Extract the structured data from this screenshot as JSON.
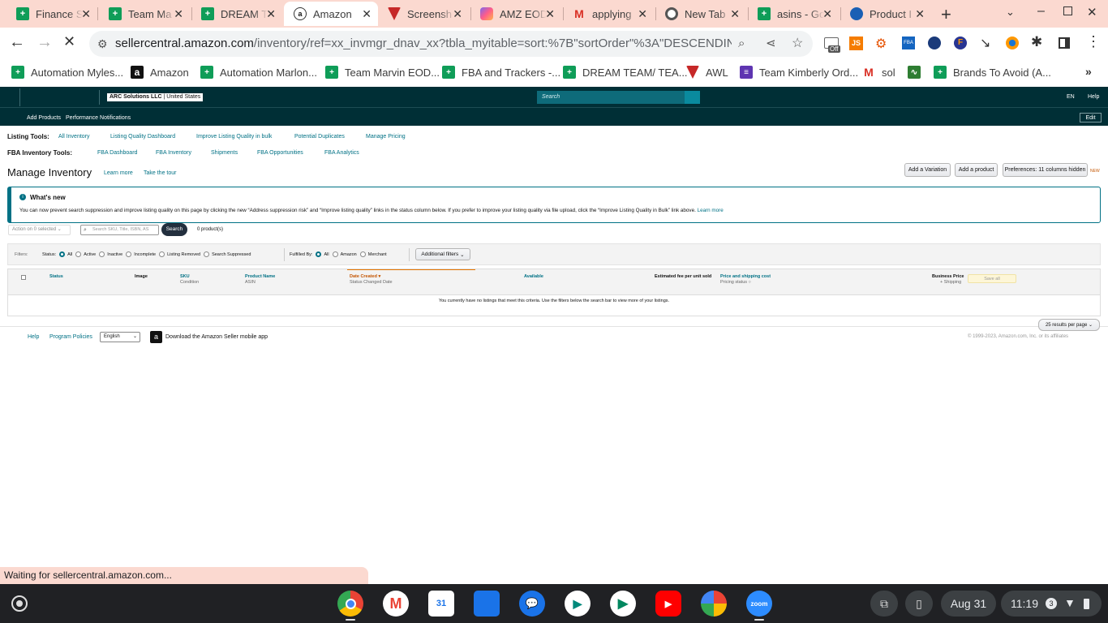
{
  "browser": {
    "tabs": [
      {
        "label": "Finance S",
        "icon": "sheets-icon"
      },
      {
        "label": "Team Ma",
        "icon": "sheets-icon"
      },
      {
        "label": "DREAM T",
        "icon": "sheets-icon"
      },
      {
        "label": "Amazon",
        "icon": "amazon-icon"
      },
      {
        "label": "Screensh",
        "icon": "screenshot-icon"
      },
      {
        "label": "AMZ EOD",
        "icon": "clickup-icon"
      },
      {
        "label": "applying",
        "icon": "gmail-icon"
      },
      {
        "label": "New Tab",
        "icon": "chrome-icon"
      },
      {
        "label": "asins - Go",
        "icon": "sheets-icon"
      },
      {
        "label": "Product I",
        "icon": "product-icon"
      }
    ],
    "url_domain": "sellercentral.amazon.com",
    "url_path": "/inventory/ref=xx_invmgr_dnav_xx?tbla_myitable=sort:%7B\"sortOrder\"%3A\"DESCENDING\"%2C\"...",
    "extension_badge": "Off",
    "bookmarks": [
      "Automation Myles...",
      "Amazon",
      "Automation Marlon...",
      "Team Marvin EOD...",
      "FBA and Trackers -...",
      "DREAM TEAM/ TEA...",
      "AWL",
      "Team Kimberly Ord...",
      "sol",
      "Brands To Avoid (A..."
    ],
    "status_text": "Waiting for sellercentral.amazon.com..."
  },
  "sc": {
    "account": "ARC Solutions LLC",
    "marketplace": "United States",
    "search_placeholder": "Search",
    "lang": "EN",
    "help": "Help",
    "nav": [
      "Add Products",
      "Performance Notifications"
    ],
    "edit": "Edit",
    "listing_tools_label": "Listing Tools:",
    "listing_tools": [
      "All Inventory",
      "Listing Quality Dashboard",
      "Improve Listing Quality in bulk",
      "Potential Duplicates",
      "Manage Pricing"
    ],
    "fba_tools_label": "FBA Inventory Tools:",
    "fba_tools": [
      "FBA Dashboard",
      "FBA Inventory",
      "Shipments",
      "FBA Opportunities",
      "FBA Analytics"
    ],
    "page_title": "Manage Inventory",
    "learn_more": "Learn more",
    "take_tour": "Take the tour",
    "btn_variation": "Add a Variation",
    "btn_product": "Add a product",
    "btn_prefs": "Preferences: 11 columns hidden",
    "new_badge": "NEW",
    "whats_new_title": "What's new",
    "whats_new_body": "You can now prevent search suppression and improve listing quality on this page by clicking the new “Address suppression risk” and “Improve listing quality” links in the status column below. If you prefer to improve your listing quality via file upload, click the “Improve Listing Quality in Bulk” link above.",
    "whats_new_link": "Learn more",
    "action_label": "Action on 0 selected",
    "search_box_placeholder": "Search SKU, Title, ISBN, AS",
    "search_btn": "Search",
    "product_count": "0 product(s)",
    "filters_label": "Filters:",
    "status_label": "Status:",
    "status_options": [
      "All",
      "Active",
      "Inactive",
      "Incomplete",
      "Listing Removed",
      "Search Suppressed"
    ],
    "fulfilled_label": "Fulfilled By:",
    "fulfilled_options": [
      "All",
      "Amazon",
      "Merchant"
    ],
    "additional_filters": "Additional filters",
    "columns": {
      "status": "Status",
      "image": "Image",
      "sku": "SKU",
      "sku_sub": "Condition",
      "product_name": "Product Name",
      "product_sub": "ASIN",
      "date_created": "Date Created",
      "date_sub": "Status Changed Date",
      "available": "Available",
      "est_fee": "Estimated fee per unit sold",
      "price": "Price and shipping cost",
      "price_sub": "Pricing status",
      "business_price": "Business Price",
      "business_sub": "+ Shipping",
      "save_all": "Save all"
    },
    "empty_msg": "You currently have no listings that meet this criteria. Use the filters below the search bar to view more of your listings.",
    "results_per_page": "25 results per page",
    "footer_help": "Help",
    "footer_policies": "Program Policies",
    "footer_lang": "English",
    "footer_app": "Download the Amazon Seller mobile app",
    "copyright": "© 1999-2023, Amazon.com, Inc. or its affiliates"
  },
  "shelf": {
    "date": "Aug 31",
    "time": "11:19",
    "notif_count": "3"
  }
}
